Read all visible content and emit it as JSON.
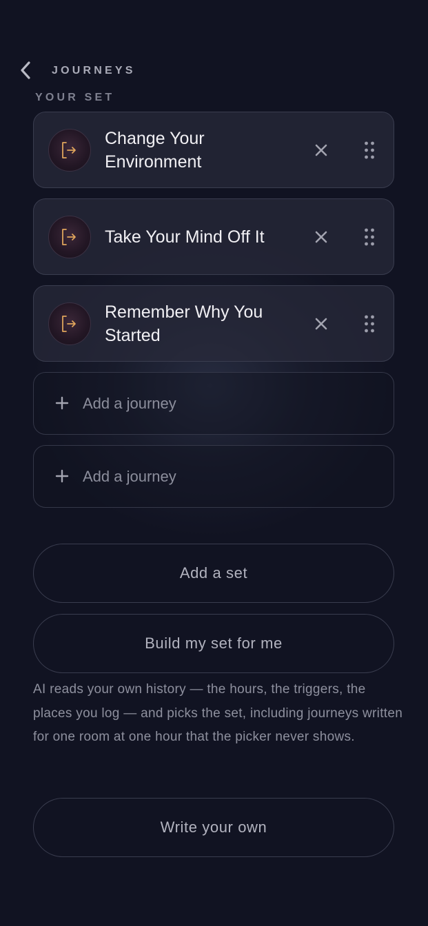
{
  "header": {
    "back_icon": "chevron-left-icon",
    "title": "JOURNEYS"
  },
  "section": {
    "label": "YOUR SET"
  },
  "set": {
    "items": [
      {
        "icon": "door-exit-icon",
        "title": "Change Your Environment"
      },
      {
        "icon": "door-exit-icon",
        "title": "Take Your Mind Off It"
      },
      {
        "icon": "door-exit-icon",
        "title": "Remember Why You Started"
      }
    ],
    "empty_slots": [
      {
        "icon": "plus-icon",
        "label": "Add a journey"
      },
      {
        "icon": "plus-icon",
        "label": "Add a journey"
      }
    ]
  },
  "actions": {
    "add_set": "Add a set",
    "build_set": "Build my set for me",
    "build_description": "AI reads your own history — the hours, the triggers, the places you log — and picks the set, including journeys written for one room at one hour that the picker never shows.",
    "write_own": "Write your own"
  },
  "colors": {
    "background": "#131525",
    "accent_icon": "#e0a55c",
    "card_border": "#3a3d4f"
  }
}
